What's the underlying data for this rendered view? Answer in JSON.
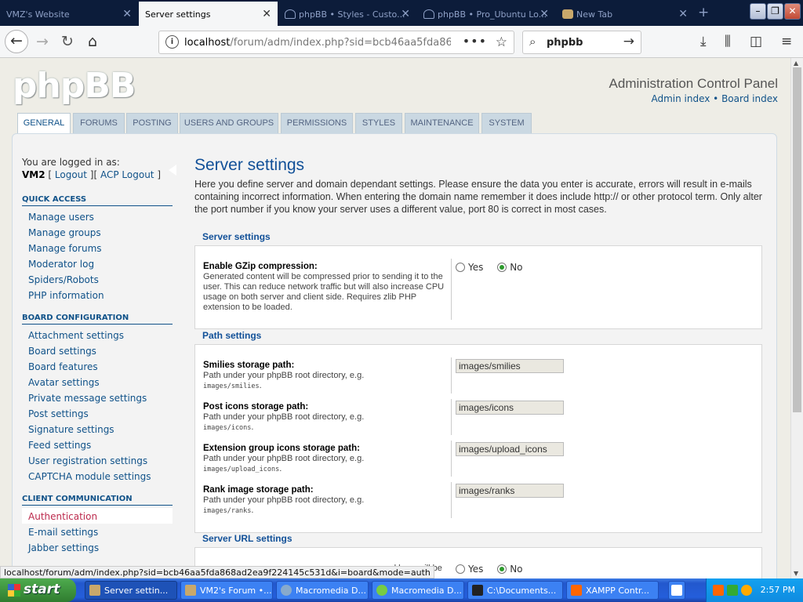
{
  "browser": {
    "tabs": [
      {
        "title": "VMZ's Website",
        "active": false
      },
      {
        "title": "Server settings",
        "active": true
      },
      {
        "title": "phpBB • Styles - Custo...",
        "active": false
      },
      {
        "title": "phpBB • Pro_Ubuntu Lo...",
        "active": false
      },
      {
        "title": "New Tab",
        "active": false
      }
    ],
    "new_tab_symbol": "+",
    "window_controls": {
      "minimize": "–",
      "restore": "❐",
      "close": "✕"
    },
    "url": {
      "host": "localhost",
      "path": "/forum/adm/index.php?sid=bcb46aa5fda868ad2e"
    },
    "search_text": "phpbb",
    "icons": [
      "back-icon",
      "forward-icon",
      "reload-icon",
      "home-icon",
      "info-icon",
      "page-actions-icon",
      "bookmark-star-icon",
      "search-icon",
      "go-arrow-icon",
      "download-icon",
      "library-icon",
      "sidebar-icon",
      "menu-icon"
    ]
  },
  "header": {
    "logo": "phpBB",
    "title": "Administration Control Panel",
    "links": {
      "admin_index": "Admin index",
      "separator": "•",
      "board_index": "Board index"
    }
  },
  "nav_tabs": [
    "GENERAL",
    "FORUMS",
    "POSTING",
    "USERS AND GROUPS",
    "PERMISSIONS",
    "STYLES",
    "MAINTENANCE",
    "SYSTEM"
  ],
  "sidebar": {
    "logged_in_label": "You are logged in as:",
    "username": "VM2",
    "logout_link": "Logout",
    "acp_logout_link": "ACP Logout",
    "sections": [
      {
        "title": "QUICK ACCESS",
        "items": [
          "Manage users",
          "Manage groups",
          "Manage forums",
          "Moderator log",
          "Spiders/Robots",
          "PHP information"
        ]
      },
      {
        "title": "BOARD CONFIGURATION",
        "items": [
          "Attachment settings",
          "Board settings",
          "Board features",
          "Avatar settings",
          "Private message settings",
          "Post settings",
          "Signature settings",
          "Feed settings",
          "User registration settings",
          "CAPTCHA module settings"
        ]
      },
      {
        "title": "CLIENT COMMUNICATION",
        "items": [
          "Authentication",
          "E-mail settings",
          "Jabber settings"
        ]
      }
    ],
    "hovered_item": "Authentication"
  },
  "main": {
    "title": "Server settings",
    "intro": "Here you define server and domain dependant settings. Please ensure the data you enter is accurate, errors will result in e-mails containing incorrect information. When entering the domain name remember it does include http:// or other protocol term. Only alter the port number if you know your server uses a different value, port 80 is correct in most cases.",
    "server_settings": {
      "legend": "Server settings",
      "gzip": {
        "label": "Enable GZip compression:",
        "help": "Generated content will be compressed prior to sending it to the user. This can reduce network traffic but will also increase CPU usage on both server and client side. Requires zlib PHP extension to be loaded.",
        "yes": "Yes",
        "no": "No",
        "selected": "No"
      }
    },
    "path_settings": {
      "legend": "Path settings",
      "fields": [
        {
          "label": "Smilies storage path:",
          "help": "Path under your phpBB root directory, e.g.",
          "example": "images/smilies",
          "value": "images/smilies"
        },
        {
          "label": "Post icons storage path:",
          "help": "Path under your phpBB root directory, e.g.",
          "example": "images/icons",
          "value": "images/icons"
        },
        {
          "label": "Extension group icons storage path:",
          "help": "Path under your phpBB root directory, e.g.",
          "example": "images/upload_icons",
          "value": "images/upload_icons"
        },
        {
          "label": "Rank image storage path:",
          "help": "Path under your phpBB root directory, e.g.",
          "example": "images/ranks",
          "value": "images/ranks"
        }
      ]
    },
    "server_url_settings": {
      "legend": "Server URL settings",
      "partial_help": "d here will be",
      "yes": "Yes",
      "no": "No",
      "selected": "No"
    }
  },
  "status_url": "localhost/forum/adm/index.php?sid=bcb46aa5fda868ad2ea9f224145c531d&i=board&mode=auth",
  "taskbar": {
    "start": "start",
    "tasks": [
      "Server settin...",
      "VM2's Forum •...",
      "Macromedia D...",
      "Macromedia D...",
      "C:\\Documents...",
      "XAMPP Contr..."
    ],
    "active_task": "Server settin...",
    "clock": "2:57 PM",
    "colors": {
      "start": "#3c8f3c",
      "bar": "#245edb",
      "tray": "#0f8be0"
    }
  },
  "colors": {
    "link": "#105289",
    "heading": "#115098",
    "hover_link": "#bc2a4d",
    "panel_bg": "#f3f3f3",
    "page_bg": "#eeede6"
  }
}
